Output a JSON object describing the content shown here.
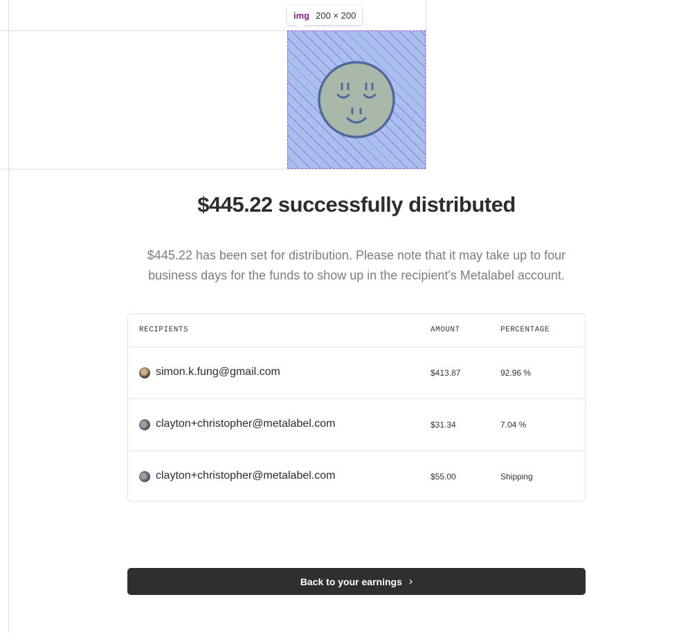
{
  "inspector": {
    "tag": "img",
    "dimensions": "200 × 200"
  },
  "title": "$445.22 successfully distributed",
  "description": "$445.22 has been set for distribution. Please note that it may take up to four business days for the funds to show up in the recipient's Metalabel account.",
  "table": {
    "headers": {
      "recipients": "RECIPIENTS",
      "amount": "AMOUNT",
      "percentage": "PERCENTAGE"
    },
    "rows": [
      {
        "email": "simon.k.fung@gmail.com",
        "amount": "$413.87",
        "percentage": "92.96 %"
      },
      {
        "email": "clayton+christopher@metalabel.com",
        "amount": "$31.34",
        "percentage": "7.04 %"
      },
      {
        "email": "clayton+christopher@metalabel.com",
        "amount": "$55.00",
        "percentage": "Shipping"
      }
    ]
  },
  "cta": {
    "label": "Back to your earnings",
    "icon": "chevron-right-icon"
  },
  "colors": {
    "hero_overlay": "#a9c0ee",
    "cta_bg": "#2f2f2f",
    "inspector_tag": "#8a1e8c"
  }
}
